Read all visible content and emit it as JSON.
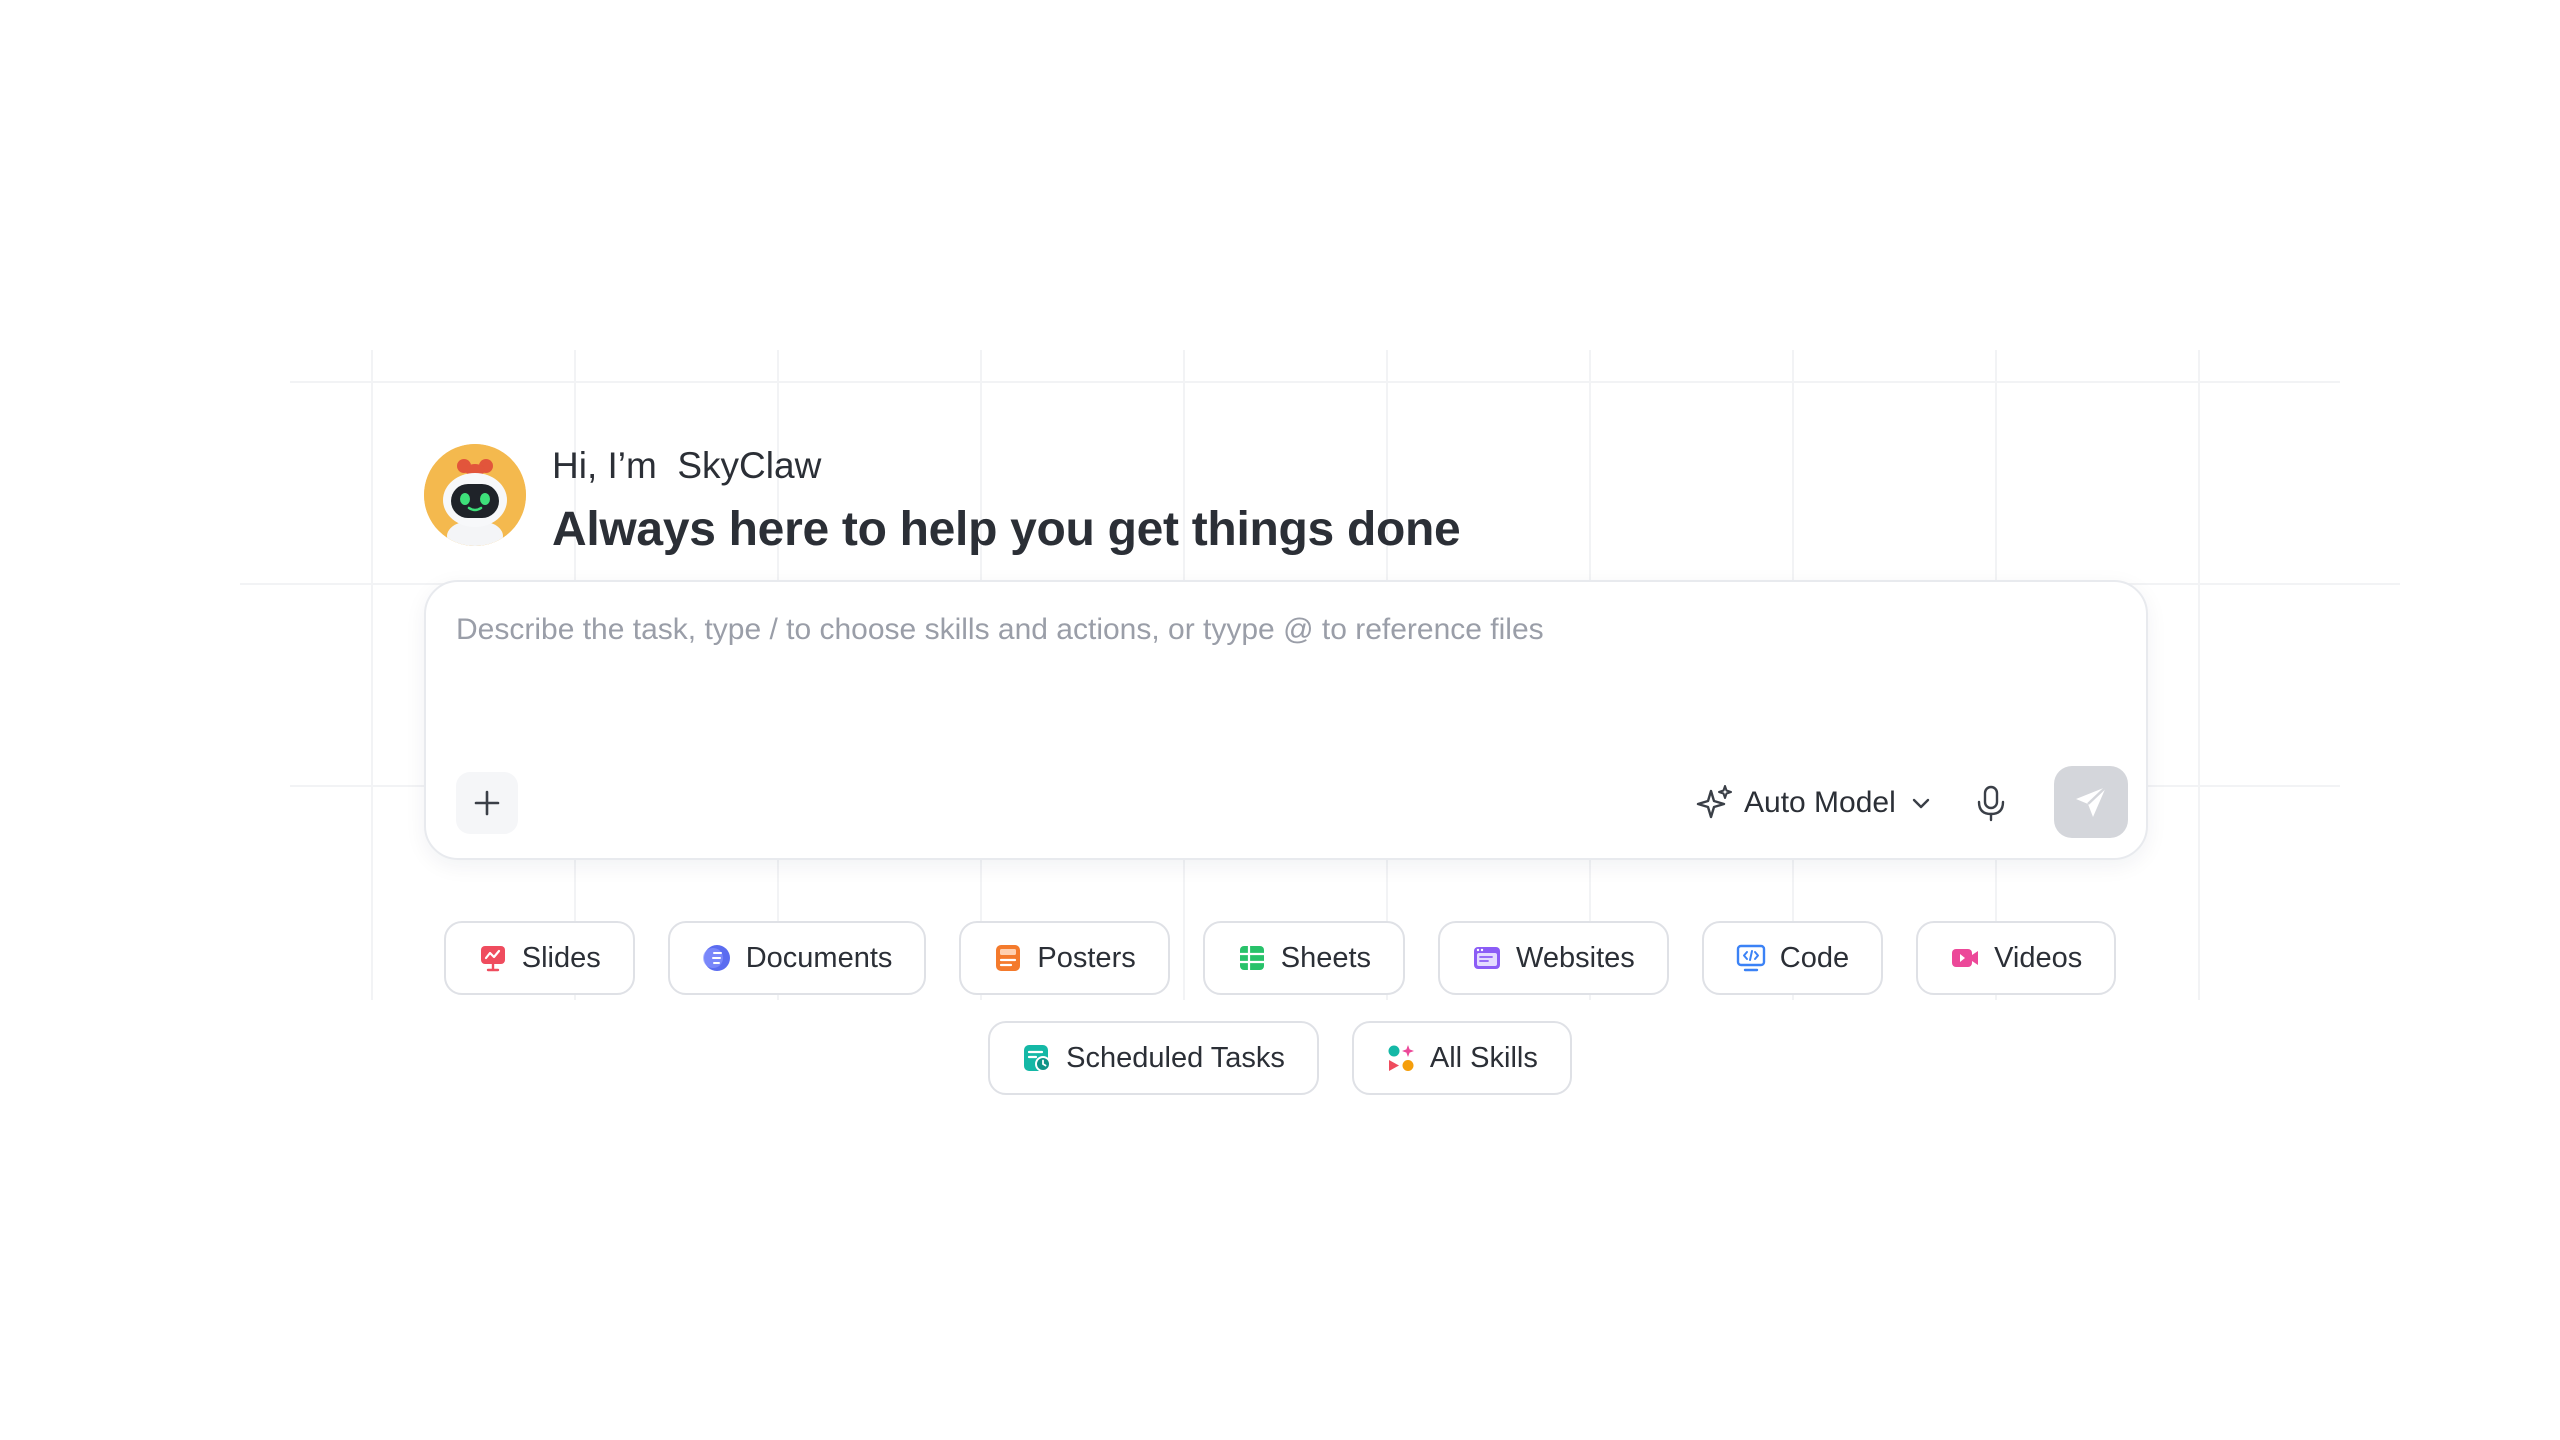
{
  "greeting": {
    "line1": "Hi, I’m  SkyClaw",
    "line2": "Always here to help you get things done",
    "avatar_icon": "robot-mascot-icon"
  },
  "composer": {
    "placeholder": "Describe the task, type / to choose skills and actions, or tyype @ to reference files",
    "model_label": "Auto Model",
    "add_icon": "plus-icon",
    "model_icon": "sparkle-icon",
    "mic_icon": "microphone-icon",
    "send_icon": "paper-plane-icon"
  },
  "skills": [
    {
      "label": "Slides",
      "icon": "slides-icon",
      "color": "#ef4c5e"
    },
    {
      "label": "Documents",
      "icon": "documents-icon",
      "color": "#5b6cf0"
    },
    {
      "label": "Posters",
      "icon": "posters-icon",
      "color": "#f47a2c"
    },
    {
      "label": "Sheets",
      "icon": "sheets-icon",
      "color": "#28c26a"
    },
    {
      "label": "Websites",
      "icon": "websites-icon",
      "color": "#8b5cf6"
    },
    {
      "label": "Code",
      "icon": "code-icon",
      "color": "#3b82f6"
    },
    {
      "label": "Videos",
      "icon": "videos-icon",
      "color": "#ec4899"
    },
    {
      "label": "Scheduled Tasks",
      "icon": "scheduled-tasks-icon",
      "color": "#14b8a6"
    },
    {
      "label": "All Skills",
      "icon": "all-skills-icon",
      "color": "#f59e0b"
    }
  ]
}
